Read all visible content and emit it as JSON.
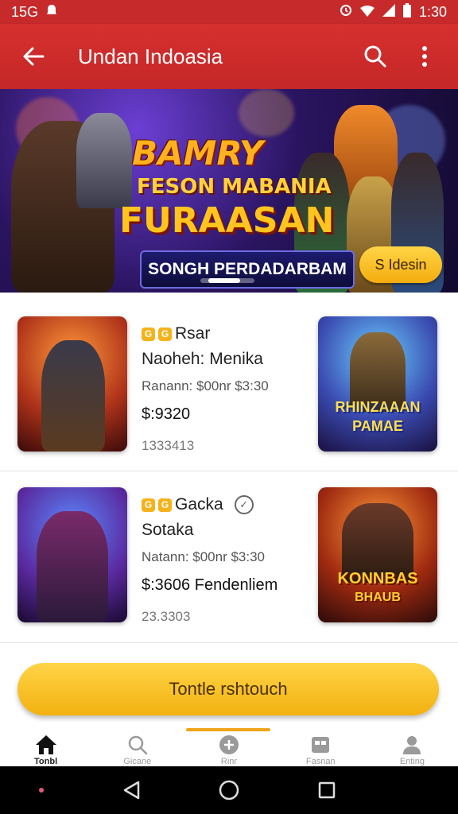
{
  "status": {
    "left": "15G",
    "time": "1:30"
  },
  "appbar": {
    "title": "Undan Indoasia"
  },
  "banner": {
    "headline1": "BAMRY",
    "headline2": "FESON MABANIA",
    "headline3": "FURAASAN",
    "ribbon": "SONGH PERDADARBAM",
    "cta": "S Idesin"
  },
  "items": [
    {
      "line1": "Rsar",
      "line2": "Naoheh: Menika",
      "price": "Ranann: $00nr $3:30",
      "amount": "$:9320",
      "count": "1333413",
      "right_thumb_text1": "RHINZAAAN",
      "right_thumb_text2": "PAMAE"
    },
    {
      "line1": "Gacka",
      "line2": "Sotaka",
      "price": "Natann: $00nr $3:30",
      "amount": "$:3606 Fendenliem",
      "count": "23.3303",
      "right_thumb_text1": "KONNBAS",
      "right_thumb_text2": "BHAUB"
    }
  ],
  "button": {
    "label": "Tontle rshtouch"
  },
  "tabs": [
    {
      "label": "Tonbl",
      "icon": "home-icon",
      "active": true
    },
    {
      "label": "Gicane",
      "icon": "search-icon",
      "active": false
    },
    {
      "label": "Rinr",
      "icon": "games-icon",
      "active": false
    },
    {
      "label": "Fasnan",
      "icon": "cards-icon",
      "active": false
    },
    {
      "label": "Enting",
      "icon": "profile-icon",
      "active": false
    }
  ],
  "colors": {
    "appbar": "#c62a2b",
    "accent": "#f2b10f",
    "tab_indicator": "#f0a418"
  }
}
